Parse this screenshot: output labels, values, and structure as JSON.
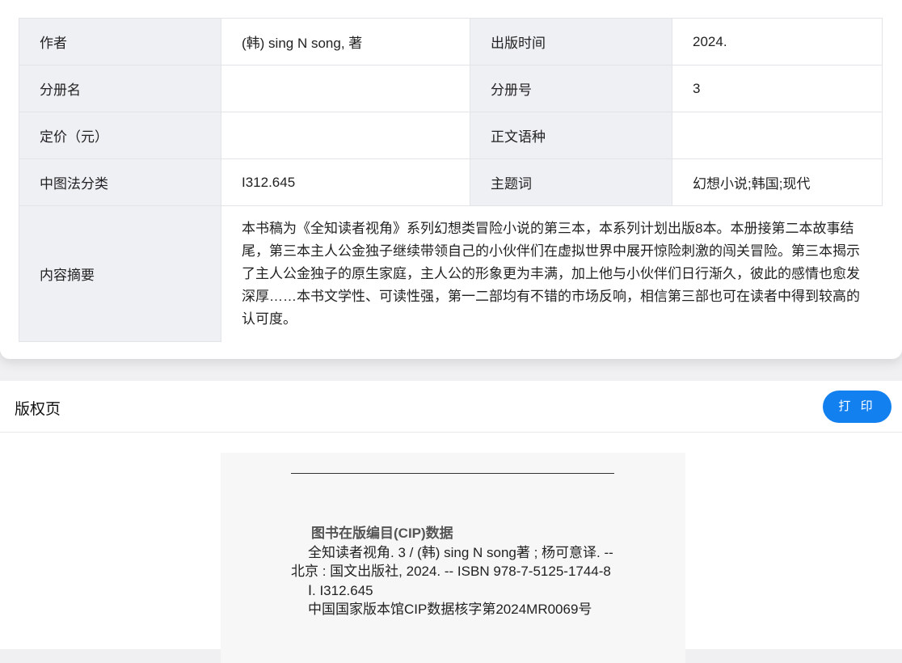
{
  "info": {
    "rows": [
      [
        "作者",
        "(韩) sing N song, 著",
        "出版时间",
        "2024."
      ],
      [
        "分册名",
        "",
        "分册号",
        "3"
      ],
      [
        "定价（元）",
        "",
        "正文语种",
        ""
      ],
      [
        "中图法分类",
        "I312.645",
        "主题词",
        "幻想小说;韩国;现代"
      ]
    ],
    "summary_label": "内容摘要",
    "summary": "本书稿为《全知读者视角》系列幻想类冒险小说的第三本，本系列计划出版8本。本册接第二本故事结尾，第三本主人公金独子继续带领自己的小伙伴们在虚拟世界中展开惊险刺激的闯关冒险。第三本揭示了主人公金独子的原生家庭，主人公的形象更为丰满，加上他与小伙伴们日行渐久，彼此的感情也愈发深厚……本书文学性、可读性强，第一二部均有不错的市场反响，相信第三部也可在读者中得到较高的认可度。"
  },
  "copyright": {
    "title": "版权页",
    "print_label": "打 印",
    "cip_heading": "图书在版编目(CIP)数据",
    "cip_line1": "全知读者视角. 3 / (韩) sing N song著 ; 杨可意译. -- 北京 : 国文出版社, 2024. -- ISBN 978-7-5125-1744-8",
    "cip_line2": "Ⅰ. I312.645",
    "cip_line3": "中国国家版本馆CIP数据核字第2024MR0069号"
  },
  "colors": {
    "accent": "#1380f0"
  }
}
